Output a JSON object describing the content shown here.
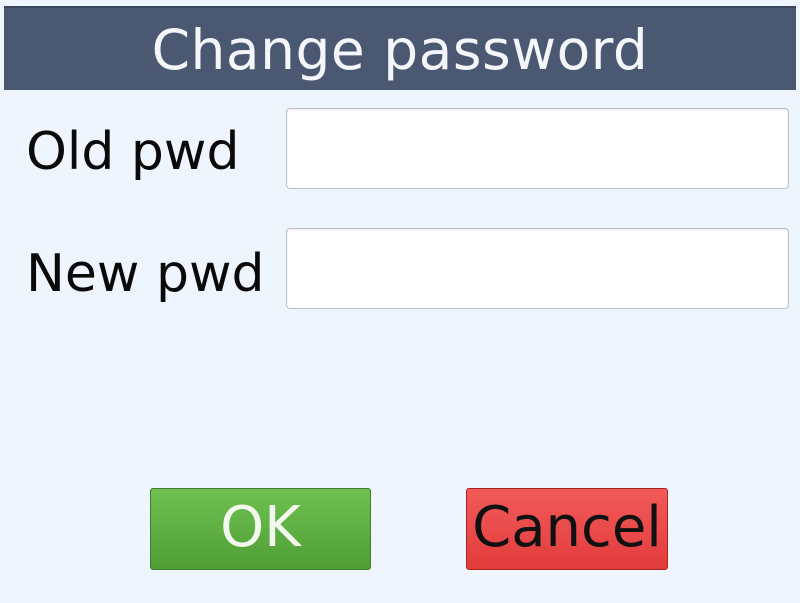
{
  "dialog": {
    "title": "Change password"
  },
  "form": {
    "old_password": {
      "label": "Old pwd",
      "value": ""
    },
    "new_password": {
      "label": "New pwd",
      "value": ""
    }
  },
  "actions": {
    "ok_label": "OK",
    "cancel_label": "Cancel"
  },
  "colors": {
    "title_bar": "#4a5872",
    "background": "#eef5fc",
    "ok_button": "#5aab3f",
    "cancel_button": "#ea4646"
  }
}
